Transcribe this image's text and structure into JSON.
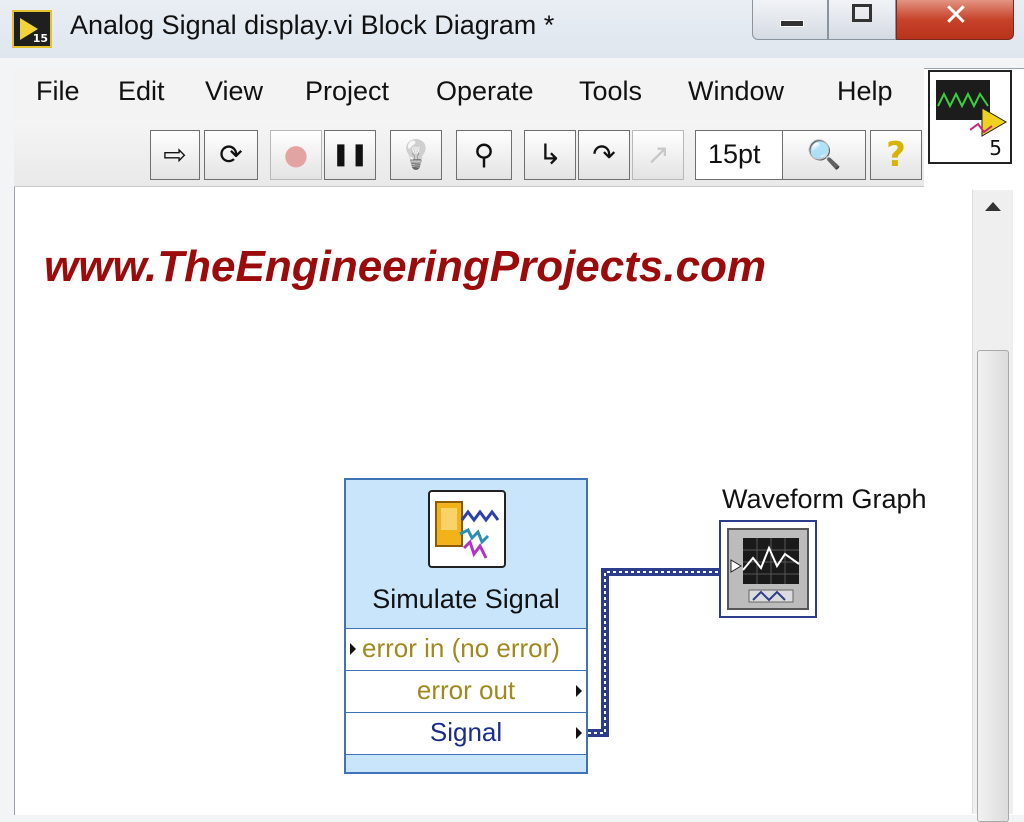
{
  "window": {
    "title": "Analog Signal display.vi Block Diagram *",
    "app_icon_text": "15",
    "close_symbol": "✕"
  },
  "menu": [
    "File",
    "Edit",
    "View",
    "Project",
    "Operate",
    "Tools",
    "Window",
    "Help"
  ],
  "toolbar": {
    "font_size": "15pt",
    "buttons": [
      {
        "name": "run-arrow-icon",
        "glyph": "⇨"
      },
      {
        "name": "run-continuously-icon",
        "glyph": "⟳"
      },
      {
        "name": "abort-icon",
        "glyph": "●"
      },
      {
        "name": "pause-icon",
        "glyph": "❚❚"
      },
      {
        "name": "highlight-execution-icon",
        "glyph": "💡"
      },
      {
        "name": "retain-wire-values-icon",
        "glyph": "⚲"
      },
      {
        "name": "step-into-icon",
        "glyph": "↳"
      },
      {
        "name": "step-over-icon",
        "glyph": "↷"
      },
      {
        "name": "step-out-icon",
        "glyph": "↗"
      },
      {
        "name": "search-icon",
        "glyph": "🔍"
      },
      {
        "name": "help-icon",
        "glyph": "?"
      }
    ]
  },
  "vi_icon_number": "5",
  "diagram": {
    "watermark": "www.TheEngineeringProjects.com",
    "simulate_signal": {
      "title": "Simulate Signal",
      "terminals": [
        "error in (no error)",
        "error out",
        "Signal"
      ]
    },
    "waveform_graph": {
      "label": "Waveform Graph"
    }
  },
  "colors": {
    "node_fill": "#c9e5fb",
    "node_border": "#3f73b8",
    "error_text": "#a08a1f",
    "signal_text": "#1c2c8a",
    "watermark": "#9b0b0b",
    "wire": "#2c3d8c"
  }
}
